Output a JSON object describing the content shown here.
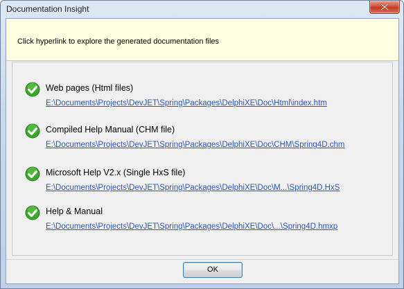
{
  "window": {
    "title": "Documentation Insight"
  },
  "header": {
    "instruction": "Click hyperlink to explore the generated documentation files"
  },
  "items": [
    {
      "title": "Web pages (Html files)",
      "link": "E:\\Documents\\Projects\\DevJET\\Spring\\Packages\\DelphiXE\\Doc\\Html\\index.htm",
      "icon": "check-icon"
    },
    {
      "title": "Compiled Help Manual (CHM file)",
      "link": "E:\\Documents\\Projects\\DevJET\\Spring\\Packages\\DelphiXE\\Doc\\CHM\\Spring4D.chm",
      "icon": "check-icon"
    },
    {
      "title": "Microsoft Help V2.x (Single HxS file)",
      "link": "E:\\Documents\\Projects\\DevJET\\Spring\\Packages\\DelphiXE\\Doc\\M...\\Spring4D.HxS",
      "icon": "check-icon"
    },
    {
      "title": "Help & Manual",
      "link": "E:\\Documents\\Projects\\DevJET\\Spring\\Packages\\DelphiXE\\Doc\\...\\Spring4D.hmxp",
      "icon": "check-icon"
    }
  ],
  "footer": {
    "ok_label": "OK"
  },
  "colors": {
    "link": "#2a56b8",
    "check_green": "#3ca52d",
    "header_bg": "#ffffe1",
    "close_red": "#c13a22"
  }
}
